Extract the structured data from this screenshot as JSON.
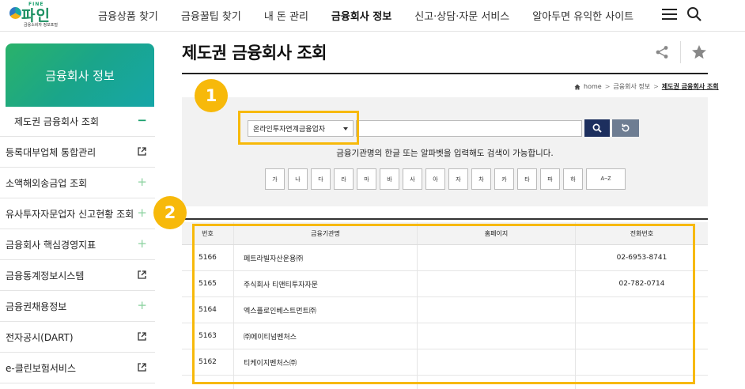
{
  "header": {
    "logo_top": "FINE",
    "logo_name": "파인",
    "logo_sub": "금융소비자 정보포털",
    "nav": [
      {
        "label": "금융상품 찾기",
        "active": false
      },
      {
        "label": "금융꿀팁 찾기",
        "active": false
      },
      {
        "label": "내 돈 관리",
        "active": false
      },
      {
        "label": "금융회사 정보",
        "active": true
      },
      {
        "label": "신고·상담·자문 서비스",
        "active": false
      },
      {
        "label": "알아두면 유익한 사이트",
        "active": false
      }
    ]
  },
  "sidebar": {
    "title": "금융회사 정보",
    "items": [
      {
        "label": "제도권 금융회사 조회",
        "icon": "minus",
        "mark": "−"
      },
      {
        "label": "등록대부업체 통합관리",
        "icon": "external-link",
        "mark": ""
      },
      {
        "label": "소액해외송금업 조회",
        "icon": "plus",
        "mark": "+"
      },
      {
        "label": "유사투자자문업자 신고현황 조회",
        "icon": "plus",
        "mark": "+"
      },
      {
        "label": "금융회사 핵심경영지표",
        "icon": "plus",
        "mark": "+"
      },
      {
        "label": "금융통계정보시스템",
        "icon": "external-link",
        "mark": ""
      },
      {
        "label": "금융권채용정보",
        "icon": "plus",
        "mark": "+"
      },
      {
        "label": "전자공시(DART)",
        "icon": "external-link",
        "mark": ""
      },
      {
        "label": "e-클린보험서비스",
        "icon": "external-link",
        "mark": ""
      }
    ]
  },
  "main": {
    "title": "제도권 금융회사 조회",
    "breadcrumb": {
      "home": "home",
      "sep": ">",
      "level1": "금융회사 정보",
      "current": "제도권 금융회사 조회"
    },
    "search": {
      "select_value": "온라인투자연계금융업자",
      "input_value": "",
      "hint": "금융기관명의 한글 또는 알파벳을 입력해도 검색이 가능합니다.",
      "letters": [
        "가",
        "나",
        "다",
        "라",
        "마",
        "바",
        "사",
        "아",
        "자",
        "차",
        "카",
        "타",
        "파",
        "하",
        "A~Z"
      ]
    },
    "table": {
      "headers": [
        "번호",
        "금융기관명",
        "홈페이지",
        "전화번호"
      ],
      "rows": [
        {
          "no": "5166",
          "name": "페트라빌자산운용㈜",
          "homepage": "",
          "phone": "02-6953-8741"
        },
        {
          "no": "5165",
          "name": "주식회사 티앤티투자자문",
          "homepage": "",
          "phone": "02-782-0714"
        },
        {
          "no": "5164",
          "name": "엑스플로인베스트먼트㈜",
          "homepage": "",
          "phone": ""
        },
        {
          "no": "5163",
          "name": "㈜에이티넘벤처스",
          "homepage": "",
          "phone": ""
        },
        {
          "no": "5162",
          "name": "티케이지벤처스㈜",
          "homepage": "",
          "phone": ""
        }
      ]
    }
  },
  "callouts": [
    "1",
    "2"
  ],
  "colors": {
    "accent": "#1aa06d",
    "callout": "#f7b90a",
    "search_button": "#1d2f5e",
    "reset_button": "#6e7d92"
  }
}
